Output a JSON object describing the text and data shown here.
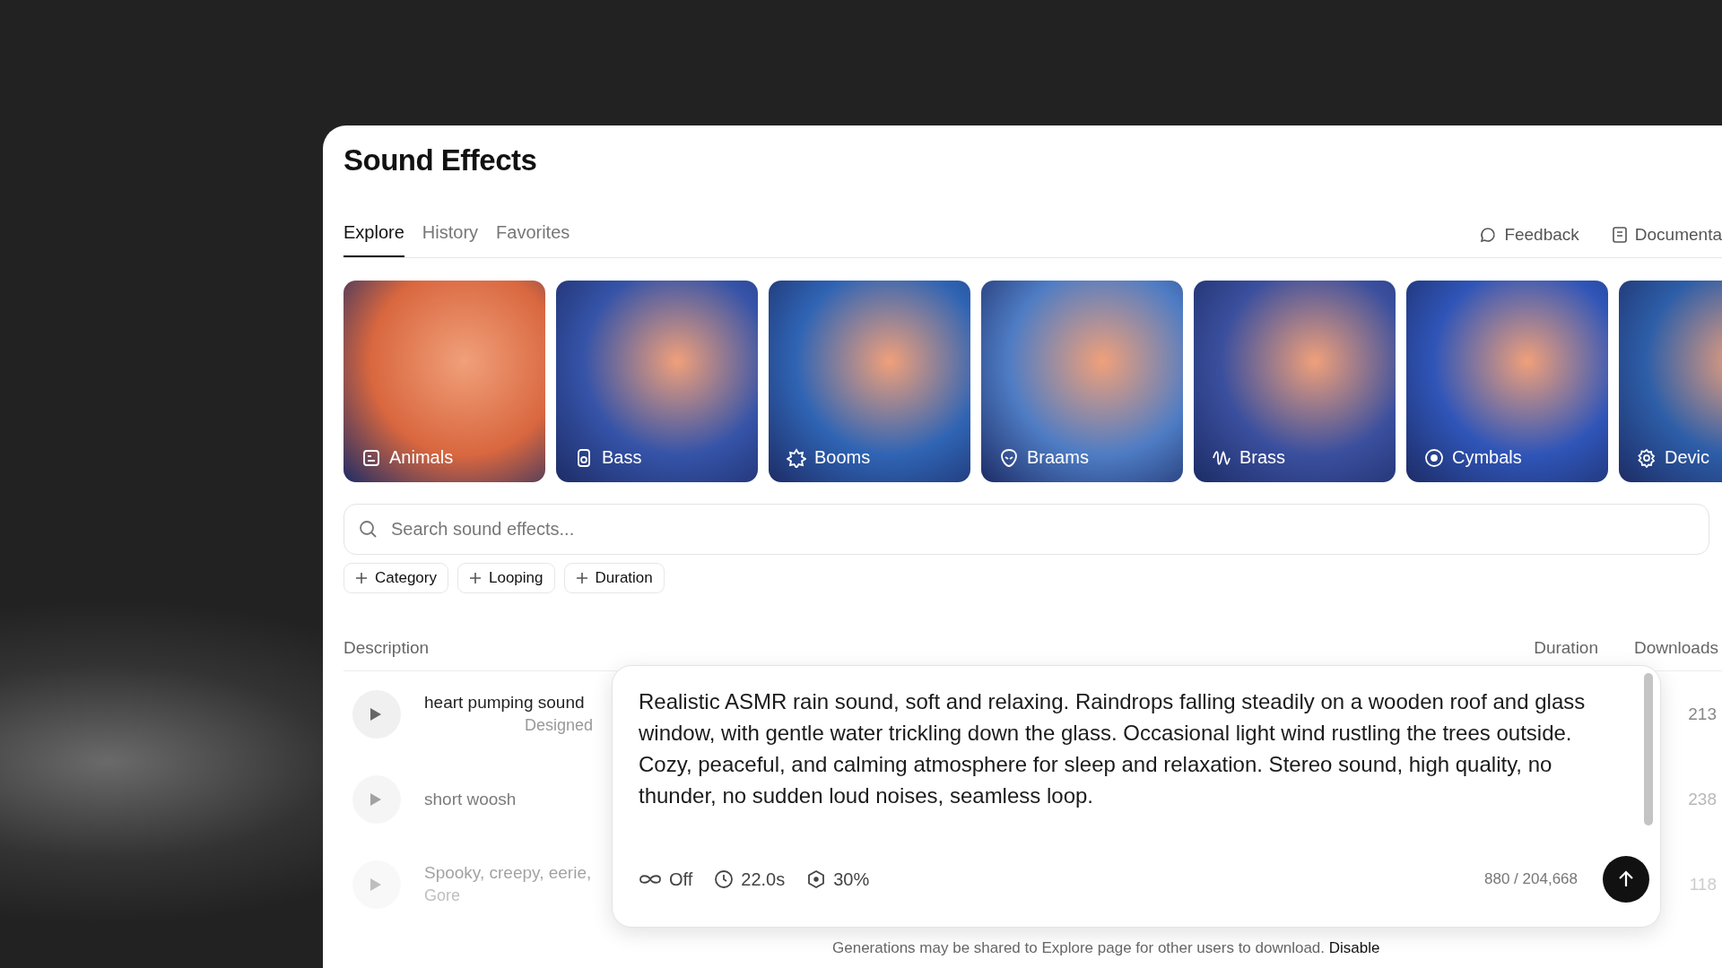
{
  "page_title": "Sound Effects",
  "tabs": [
    {
      "label": "Explore",
      "selected": true
    },
    {
      "label": "History",
      "selected": false
    },
    {
      "label": "Favorites",
      "selected": false
    }
  ],
  "header_links": [
    {
      "kind": "feedback",
      "label": "Feedback"
    },
    {
      "kind": "docs",
      "label": "Documenta"
    }
  ],
  "categories": [
    {
      "label": "Animals",
      "color": "#d9673f"
    },
    {
      "label": "Bass",
      "color": "#3553a8"
    },
    {
      "label": "Booms",
      "color": "#2f64b4"
    },
    {
      "label": "Braams",
      "color": "#4e7cc4"
    },
    {
      "label": "Brass",
      "color": "#3a4f9e"
    },
    {
      "label": "Cymbals",
      "color": "#2f55b8"
    },
    {
      "label": "Devic",
      "color": "#2d5ea8"
    }
  ],
  "search": {
    "placeholder": "Search sound effects..."
  },
  "filters": [
    "Category",
    "Looping",
    "Duration"
  ],
  "table": {
    "columns": [
      "Description",
      "Duration",
      "Downloads"
    ],
    "rows": [
      {
        "title": "heart pumping sound",
        "subtitle": "Designed",
        "downloads": "213"
      },
      {
        "title": "short woosh",
        "downloads": "238"
      },
      {
        "title": "Spooky, creepy, eerie,",
        "subtitle": "Gore",
        "downloads": "118"
      }
    ]
  },
  "composer": {
    "value": "Realistic ASMR rain sound, soft and relaxing. Raindrops falling steadily on a wooden roof and glass window, with gentle water trickling down the glass. Occasional light wind rustling the trees outside. Cozy, peaceful, and calming atmosphere for sleep and relaxation. Stereo sound, high quality, no thunder, no sudden loud noises, seamless loop.",
    "options": [
      {
        "kind": "loop",
        "label": "Off"
      },
      {
        "kind": "duration",
        "label": "22.0s"
      },
      {
        "kind": "influence",
        "label": "30%"
      }
    ],
    "counter": "880 / 204,668"
  },
  "footer": {
    "text": "Generations may be shared to Explore page for other users to download.",
    "link": "Disable"
  }
}
